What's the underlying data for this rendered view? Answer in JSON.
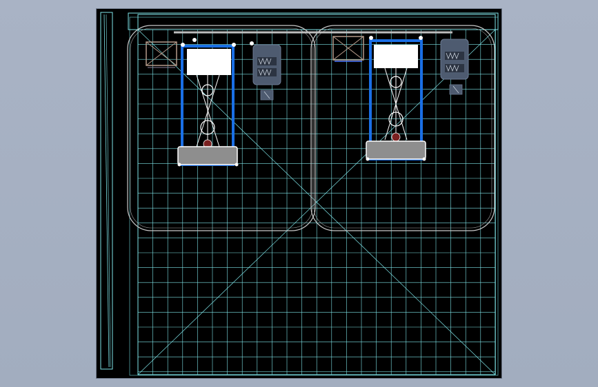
{
  "drawing": {
    "name": "cad-drawing-viewport",
    "equipment_units": [
      {
        "id": "left-unit"
      },
      {
        "id": "right-unit"
      }
    ]
  }
}
